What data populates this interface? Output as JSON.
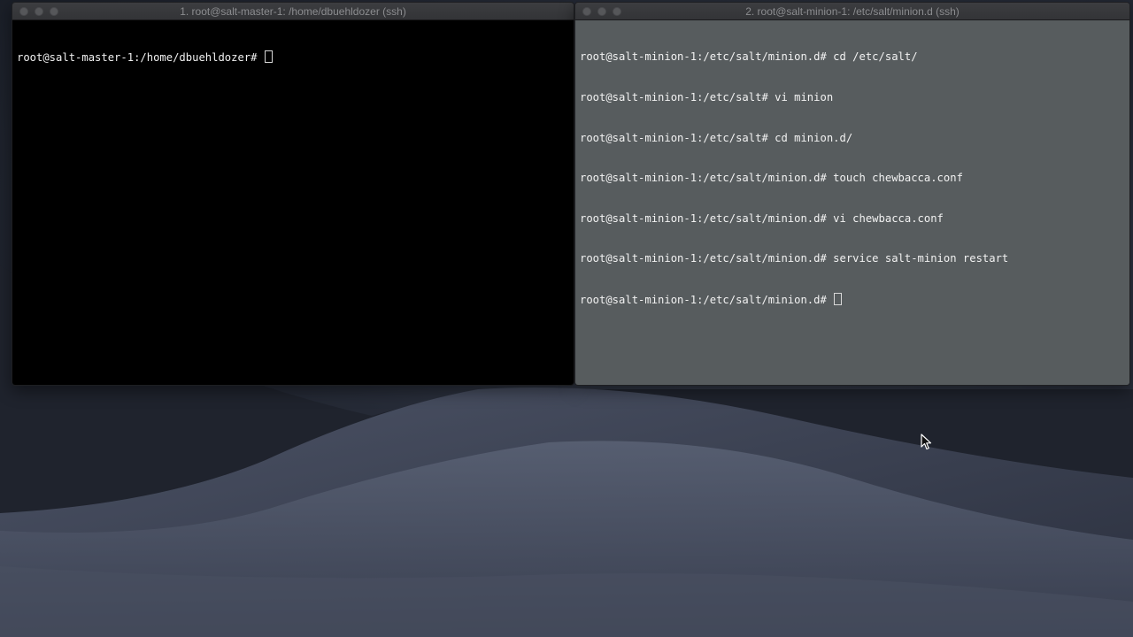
{
  "windows": {
    "left": {
      "title": "1. root@salt-master-1: /home/dbuehldozer (ssh)",
      "lines": [
        "root@salt-master-1:/home/dbuehldozer# "
      ]
    },
    "right": {
      "title": "2. root@salt-minion-1: /etc/salt/minion.d (ssh)",
      "lines": [
        "root@salt-minion-1:/etc/salt/minion.d# cd /etc/salt/",
        "root@salt-minion-1:/etc/salt# vi minion",
        "root@salt-minion-1:/etc/salt# cd minion.d/",
        "root@salt-minion-1:/etc/salt/minion.d# touch chewbacca.conf",
        "root@salt-minion-1:/etc/salt/minion.d# vi chewbacca.conf",
        "root@salt-minion-1:/etc/salt/minion.d# service salt-minion restart",
        "root@salt-minion-1:/etc/salt/minion.d# "
      ]
    }
  },
  "icons": {
    "close": "close-icon",
    "minimize": "minimize-icon",
    "zoom": "zoom-icon",
    "pointer": "mouse-pointer-icon"
  },
  "colors": {
    "left_terminal_bg": "#000000",
    "right_terminal_bg": "#575c5e",
    "titlebar": "#38393c"
  }
}
